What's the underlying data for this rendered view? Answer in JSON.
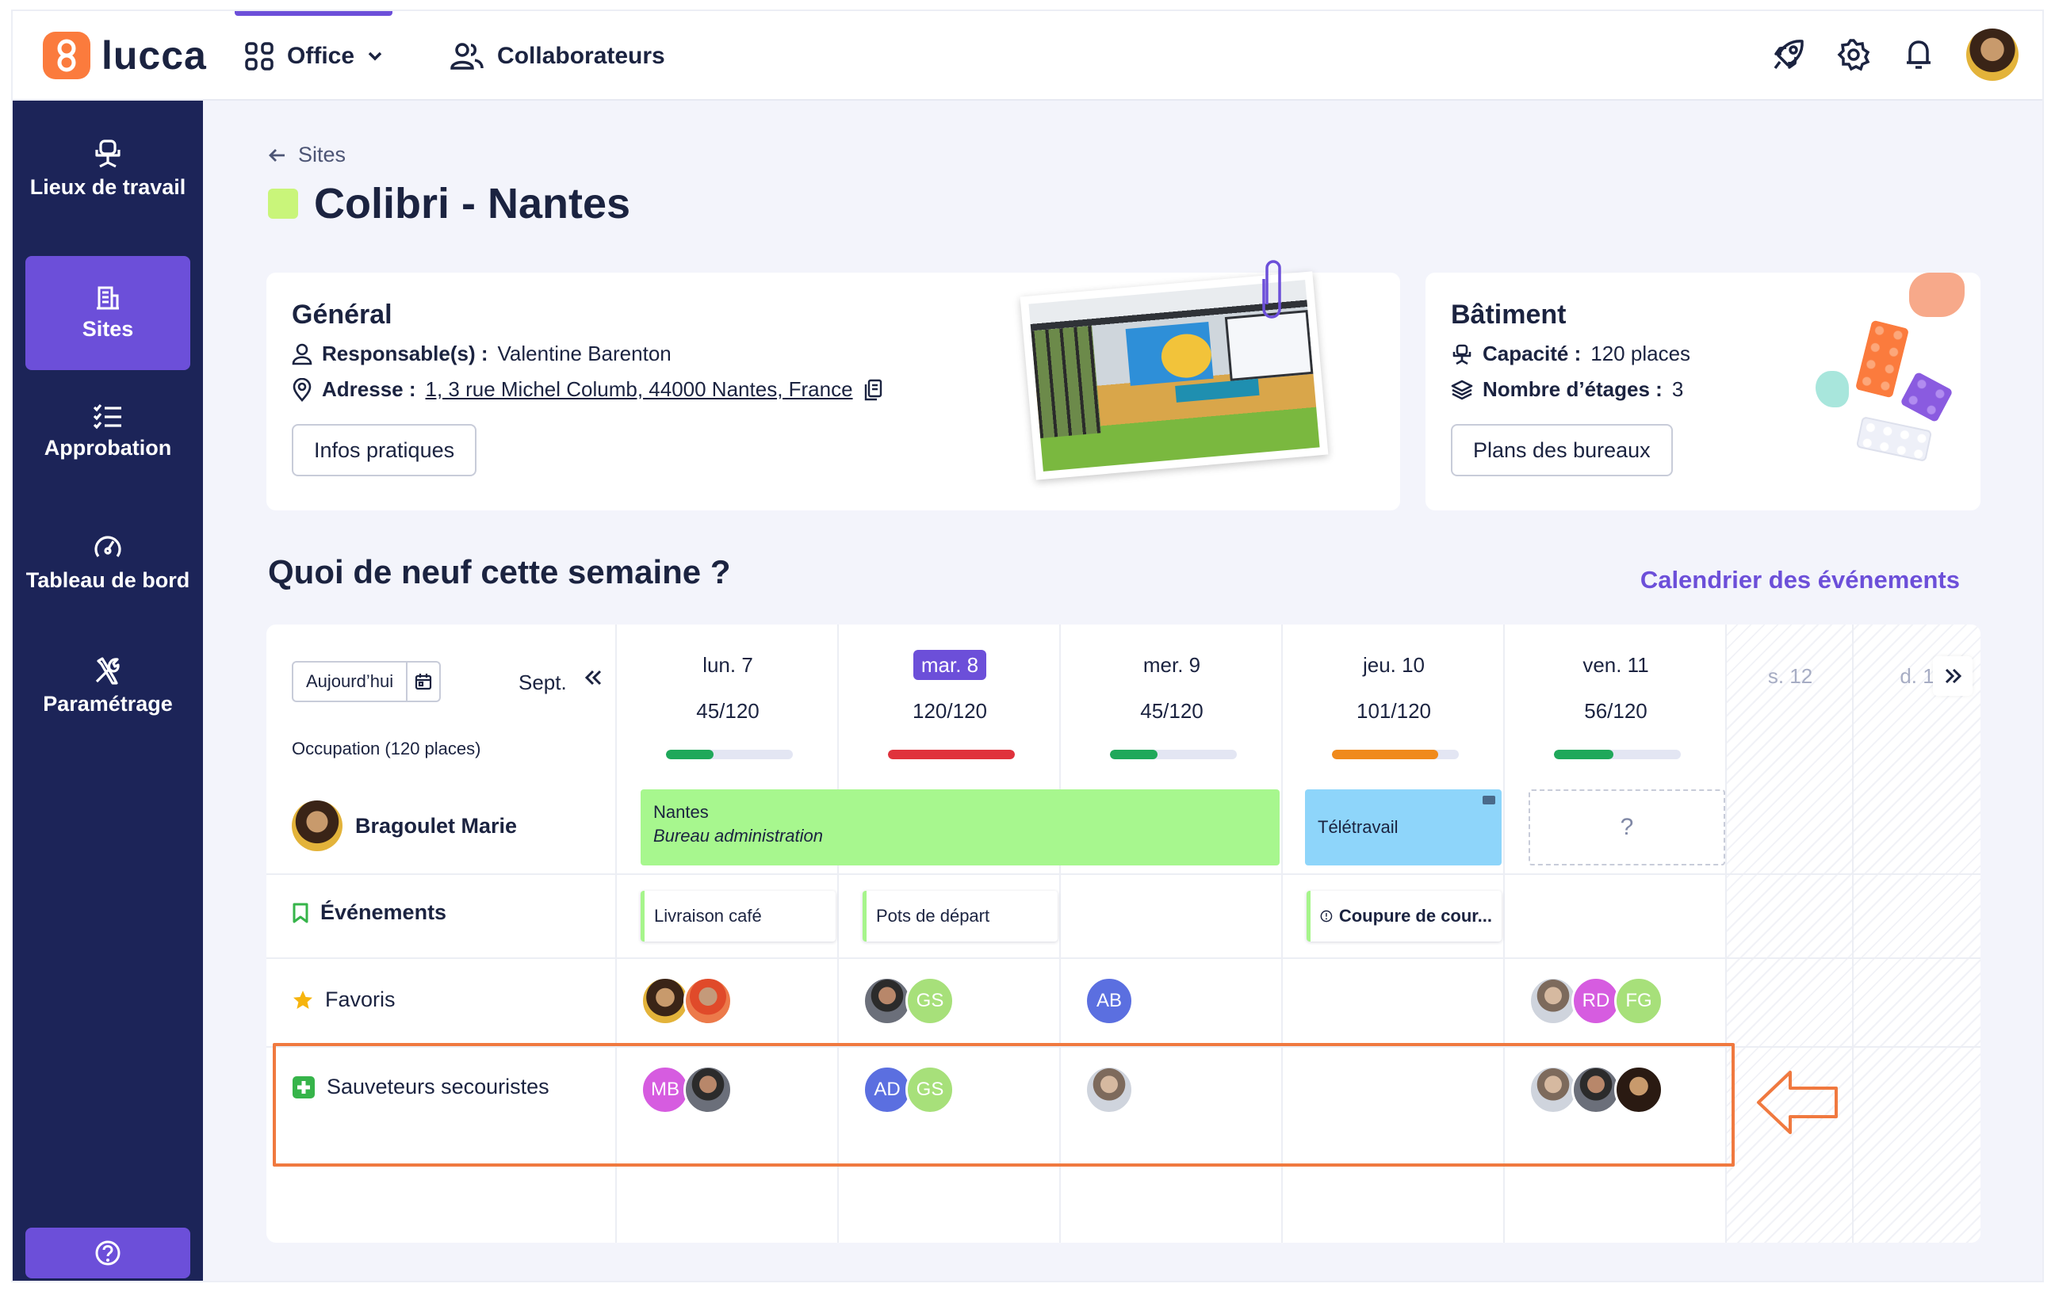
{
  "app": {
    "brand": "lucca",
    "nav": [
      {
        "label": "Office",
        "icon": "grid-icon",
        "active": true,
        "dropdown": true
      },
      {
        "label": "Collaborateurs",
        "icon": "users-icon",
        "active": false
      }
    ],
    "top_icons": [
      "rocket-icon",
      "gear-icon",
      "bell-icon",
      "user-avatar"
    ]
  },
  "sidebar": {
    "items": [
      {
        "label": "Lieux de travail",
        "icon": "desk-chair-icon",
        "active": false
      },
      {
        "label": "Sites",
        "icon": "building-icon",
        "active": true
      },
      {
        "label": "Approbation",
        "icon": "checklist-icon",
        "active": false
      },
      {
        "label": "Tableau de bord",
        "icon": "gauge-icon",
        "active": false
      },
      {
        "label": "Paramétrage",
        "icon": "tools-icon",
        "active": false
      }
    ],
    "help_icon": "help-icon"
  },
  "page": {
    "breadcrumb": "Sites",
    "title": "Colibri - Nantes",
    "swatch_color": "#c9f57a"
  },
  "general": {
    "heading": "Général",
    "responsable_label": "Responsable(s) :",
    "responsable_value": "Valentine Barenton",
    "adresse_label": "Adresse :",
    "adresse_value": "1, 3 rue Michel Columb, 44000 Nantes, France",
    "button": "Infos pratiques"
  },
  "batiment": {
    "heading": "Bâtiment",
    "capacite_label": "Capacité :",
    "capacite_value": "120 places",
    "etages_label": "Nombre d’étages :",
    "etages_value": "3",
    "button": "Plans des bureaux"
  },
  "week": {
    "title": "Quoi de neuf cette semaine ?",
    "events_link": "Calendrier des événements",
    "today_button": "Aujourd’hui",
    "month": "Sept.",
    "occupation_label": "Occupation (120 places)",
    "days": [
      {
        "name": "lun. 7",
        "occupancy": "45/120",
        "fill": 0.375,
        "color": "#1fa85a",
        "today": false
      },
      {
        "name": "mar. 8",
        "occupancy": "120/120",
        "fill": 1.0,
        "color": "#e0323c",
        "today": true
      },
      {
        "name": "mer. 9",
        "occupancy": "45/120",
        "fill": 0.375,
        "color": "#1fa85a",
        "today": false
      },
      {
        "name": "jeu. 10",
        "occupancy": "101/120",
        "fill": 0.84,
        "color": "#f08a1c",
        "today": false
      },
      {
        "name": "ven. 11",
        "occupancy": "56/120",
        "fill": 0.47,
        "color": "#1fa85a",
        "today": false
      }
    ],
    "weekend": [
      "s. 12",
      "d. 1"
    ],
    "person": "Bragoulet Marie",
    "plan": {
      "office_title": "Nantes",
      "office_subtitle": "Bureau administration",
      "remote": "Télétravail",
      "unknown": "?"
    },
    "rows": {
      "evenements": "Événements",
      "favoris": "Favoris",
      "sauveteurs": "Sauveteurs secouristes"
    },
    "events": [
      "Livraison café",
      "Pots de départ",
      "Coupure de cour..."
    ],
    "favoris_initials": {
      "gs": "GS",
      "ab": "AB",
      "rd": "RD",
      "fg": "FG"
    },
    "sauveteurs_initials": {
      "mb": "MB",
      "ad": "AD",
      "gs": "GS"
    }
  }
}
